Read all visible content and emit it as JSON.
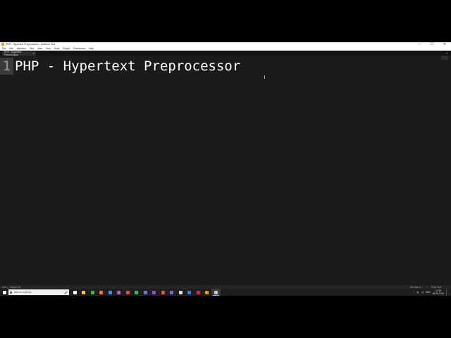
{
  "window": {
    "title": "PHP - Hypertext Preprocessor - Sublime Text",
    "controls": {
      "minimize": "─",
      "maximize": "☐",
      "close": "✕"
    }
  },
  "menu": [
    "File",
    "Edit",
    "Selection",
    "Find",
    "View",
    "Goto",
    "Tools",
    "Project",
    "Preferences",
    "Help"
  ],
  "tab": {
    "label": "PHP - Hypertext Preprocessor",
    "close": "×"
  },
  "editor": {
    "line_number": "1",
    "line_text": "PHP - Hypertext Preprocessor"
  },
  "status": {
    "position": "Line 1, Column 29",
    "tab_size": "Tab Size: 4",
    "syntax": "Plain Text"
  },
  "taskbar": {
    "search_placeholder": "Ask me anything",
    "apps": [
      {
        "icon": "task-view-icon",
        "color": "#ffffff"
      },
      {
        "icon": "file-explorer-icon",
        "color": "#f4c542"
      },
      {
        "icon": "chrome-icon",
        "color": "#4caf50"
      },
      {
        "icon": "firefox-icon",
        "color": "#ff7043"
      },
      {
        "icon": "app-icon-1",
        "color": "#4a90e2"
      },
      {
        "icon": "app-icon-2",
        "color": "#b05fc4"
      },
      {
        "icon": "app-icon-3",
        "color": "#e84d4d"
      },
      {
        "icon": "app-icon-4",
        "color": "#3fb950"
      },
      {
        "icon": "app-icon-5",
        "color": "#6b7bdc"
      },
      {
        "icon": "app-icon-6",
        "color": "#9c4dcc"
      },
      {
        "icon": "app-icon-7",
        "color": "#d9534f"
      },
      {
        "icon": "app-icon-8",
        "color": "#7b68ee"
      },
      {
        "icon": "app-icon-9",
        "color": "#e0e0e0"
      },
      {
        "icon": "app-icon-10",
        "color": "#2e86de"
      },
      {
        "icon": "app-icon-11",
        "color": "#d7263d"
      },
      {
        "icon": "app-icon-12",
        "color": "#f39c12"
      },
      {
        "icon": "sublime-text-icon",
        "color": "#cccccc",
        "active": true
      }
    ],
    "tray": {
      "language": "DAN",
      "time": "15:38",
      "date": "06-06-2016"
    }
  },
  "colors": {
    "editor_bg": "#1b1b1b",
    "text": "#ffffff",
    "gutter_highlight": "#3a3a3a"
  }
}
